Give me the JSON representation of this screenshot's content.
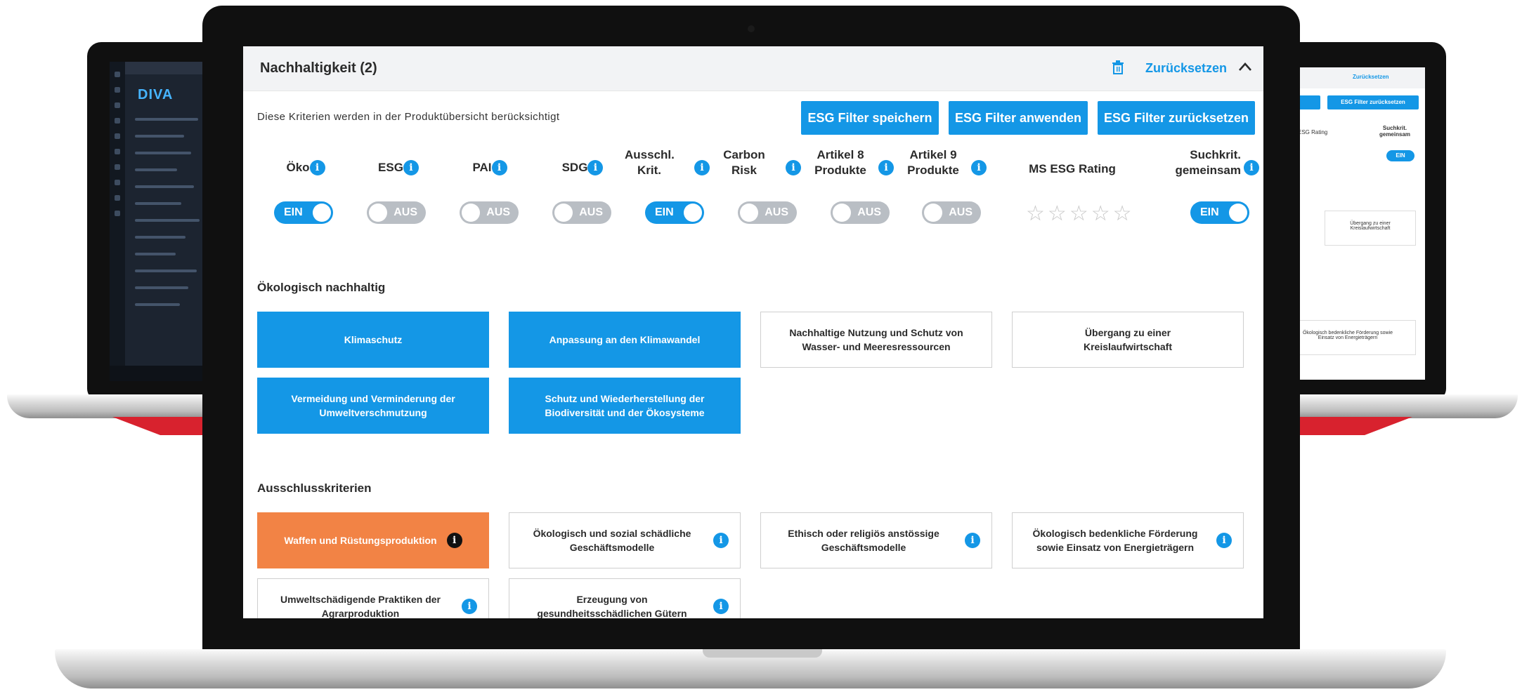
{
  "panel": {
    "title": "Nachhaltigkeit (2)",
    "reset_label": "Zurücksetzen",
    "description": "Diese Kriterien werden in der Produktübersicht berücksichtigt"
  },
  "buttons": {
    "save": "ESG Filter speichern",
    "apply": "ESG Filter anwenden",
    "reset": "ESG Filter zurücksetzen"
  },
  "criteria": [
    {
      "label": "Öko",
      "state": "EIN"
    },
    {
      "label": "ESG",
      "state": "AUS"
    },
    {
      "label": "PAI",
      "state": "AUS"
    },
    {
      "label": "SDG",
      "state": "AUS"
    },
    {
      "label": "Ausschl. Krit.",
      "state": "EIN"
    },
    {
      "label": "Carbon Risk",
      "state": "AUS"
    },
    {
      "label": "Artikel 8 Produkte",
      "state": "AUS"
    },
    {
      "label": "Artikel 9 Produkte",
      "state": "AUS"
    },
    {
      "label": "MS ESG Rating",
      "rating": 0,
      "max": 5
    },
    {
      "label": "Suchkrit. gemeinsam",
      "state": "EIN"
    }
  ],
  "ecological": {
    "title": "Ökologisch nachhaltig",
    "tiles": [
      {
        "label": "Klimaschutz",
        "selected": true
      },
      {
        "label": "Anpassung an den Klimawandel",
        "selected": true
      },
      {
        "label": "Nachhaltige Nutzung und Schutz von Wasser- und Meeresressourcen",
        "selected": false
      },
      {
        "label": "Übergang zu einer Kreislaufwirtschaft",
        "selected": false
      },
      {
        "label": "Vermeidung und Verminderung der Umweltverschmutzung",
        "selected": true
      },
      {
        "label": "Schutz und Wiederherstellung der Biodiversität und der Ökosysteme",
        "selected": true
      }
    ]
  },
  "exclusion": {
    "title": "Ausschlusskriterien",
    "tiles": [
      {
        "label": "Waffen und Rüstungsproduktion",
        "selected": true
      },
      {
        "label": "Ökologisch und sozial schädliche Geschäftsmodelle",
        "selected": false
      },
      {
        "label": "Ethisch oder religiös anstössige Geschäftsmodelle",
        "selected": false
      },
      {
        "label": "Ökologisch bedenkliche Förderung sowie Einsatz von Energieträgern",
        "selected": false
      },
      {
        "label": "Umweltschädigende Praktiken der Agrarproduktion",
        "selected": false
      },
      {
        "label": "Erzeugung von gesundheitsschädlichen Gütern",
        "selected": false
      }
    ]
  },
  "colors": {
    "accent": "#1497e6",
    "excluded": "#f28345",
    "toggle_off": "#b9bec4"
  },
  "background_devices": {
    "left_logo": "DIVA",
    "right_reset": "Zurücksetzen",
    "right_button": "ESG Filter zurücksetzen",
    "right_rating": "ESG Rating",
    "right_search": "Suchkrit. gemeinsam",
    "right_toggle": "EIN",
    "right_tile1": "Übergang zu einer Kreislaufwirtschaft",
    "right_tile2": "Ökologisch bedenkliche Förderung sowie Einsatz von Energieträgern"
  }
}
